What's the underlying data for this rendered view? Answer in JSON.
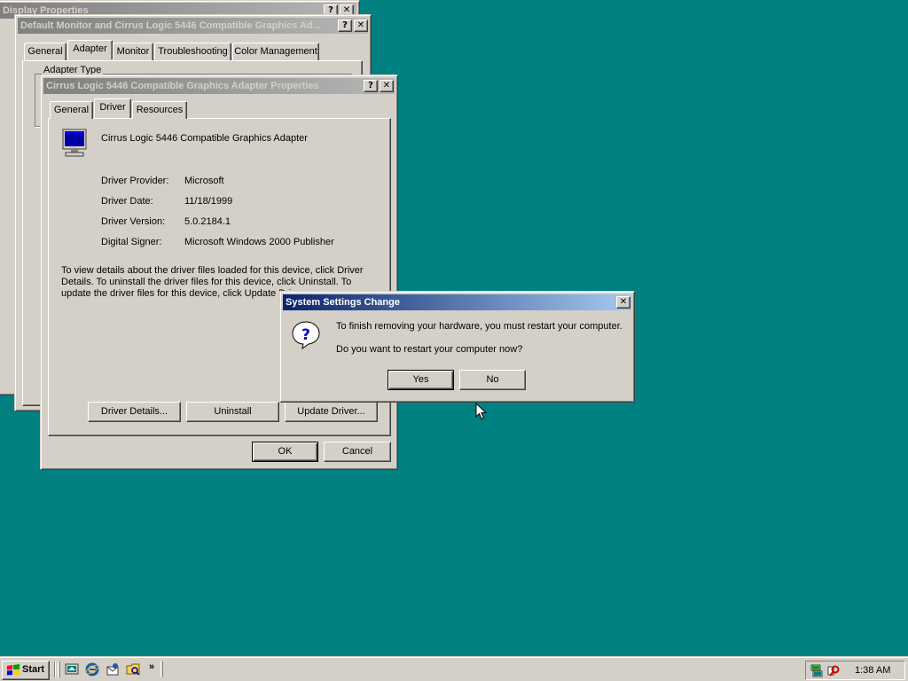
{
  "colors": {
    "desktop": "#008080",
    "active_title_start": "#0a246a",
    "active_title_end": "#a6caf0",
    "inactive_title_start": "#808080",
    "inactive_title_end": "#b5b5b5",
    "face": "#d4d0c8"
  },
  "display_props": {
    "title": "Display Properties"
  },
  "monitor_props": {
    "title": "Default Monitor and Cirrus Logic 5446 Compatible Graphics Ad...",
    "tabs": [
      "General",
      "Adapter",
      "Monitor",
      "Troubleshooting",
      "Color Management"
    ],
    "selected_tab": "Adapter",
    "group_label": "Adapter Type"
  },
  "adapter_props": {
    "title": "Cirrus Logic 5446 Compatible Graphics Adapter Properties",
    "tabs": [
      "General",
      "Driver",
      "Resources"
    ],
    "selected_tab": "Driver",
    "device_name": "Cirrus Logic 5446 Compatible Graphics Adapter",
    "device_icon": "monitor-icon",
    "fields": [
      {
        "label": "Driver Provider:",
        "value": "Microsoft"
      },
      {
        "label": "Driver Date:",
        "value": "11/18/1999"
      },
      {
        "label": "Driver Version:",
        "value": "5.0.2184.1"
      },
      {
        "label": "Digital Signer:",
        "value": "Microsoft Windows 2000 Publisher"
      }
    ],
    "description": "To view details about the driver files loaded for this device, click Driver Details. To uninstall the driver files for this device, click Uninstall. To update the driver files for this device, click Update Driver.",
    "buttons": {
      "details": "Driver Details...",
      "uninstall": "Uninstall",
      "update": "Update Driver...",
      "ok": "OK",
      "cancel": "Cancel"
    }
  },
  "dialog": {
    "title": "System Settings Change",
    "icon": "question-icon",
    "message1": "To finish removing your hardware, you must restart your computer.",
    "message2": "Do you want to restart your computer now?",
    "yes": "Yes",
    "no": "No"
  },
  "title_buttons": {
    "help": "?",
    "close": "✕"
  },
  "taskbar": {
    "start_label": "Start",
    "clock": "1:38 AM",
    "quick_launch": [
      "desktop-icon",
      "ie-icon",
      "outlook-icon",
      "folder-icon"
    ],
    "chevron": "»"
  }
}
